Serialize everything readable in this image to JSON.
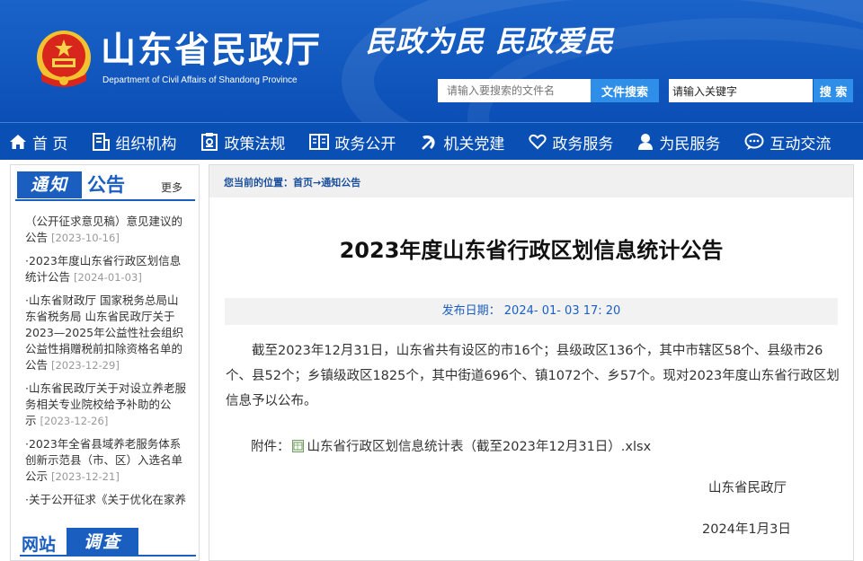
{
  "header": {
    "site_title": "山东省民政厅",
    "site_subtitle": "Department of Civil Affairs of Shandong Province",
    "slogan": "民政为民  民政爱民",
    "file_search": {
      "placeholder": "请输入要搜索的文件名",
      "button": "文件搜索"
    },
    "keyword_search": {
      "value": "请输入关键字",
      "button": "搜 索"
    }
  },
  "nav": {
    "items": [
      {
        "label": "首 页",
        "icon": "home-icon"
      },
      {
        "label": "组织机构",
        "icon": "org-icon"
      },
      {
        "label": "政策法规",
        "icon": "policy-icon"
      },
      {
        "label": "政务公开",
        "icon": "book-icon"
      },
      {
        "label": "机关党建",
        "icon": "party-icon"
      },
      {
        "label": "政务服务",
        "icon": "heart-icon"
      },
      {
        "label": "为民服务",
        "icon": "person-icon"
      },
      {
        "label": "互动交流",
        "icon": "chat-icon"
      }
    ]
  },
  "sidebar": {
    "notice_tag": "通知",
    "notice_title": "公告",
    "more": "更多",
    "notices": [
      {
        "title": "（公开征求意见稿）意见建议的",
        "title2": "公告",
        "date": "[2023-10-16]"
      },
      {
        "title": "·2023年度山东省行政区划信息",
        "title2": "统计公告",
        "date": "[2024-01-03]"
      },
      {
        "title": "·山东省财政厅 国家税务总局山",
        "title2": "东省税务局 山东省民政厅关于",
        "title3": "2023—2025年公益性社会组织",
        "title4": "公益性捐赠税前扣除资格名单的",
        "title5": "公告",
        "date": "[2023-12-29]"
      },
      {
        "title": "·山东省民政厅关于对设立养老服",
        "title2": "务相关专业院校给予补助的公",
        "title3": "示",
        "date": "[2023-12-26]"
      },
      {
        "title": "·2023年全省县域养老服务体系",
        "title2": "创新示范县（市、区）入选名单",
        "title3": "公示",
        "date": "[2023-12-21]"
      },
      {
        "title": "·关于公开征求《关于优化在家养"
      }
    ],
    "survey_left": "网站",
    "survey_right": "调查"
  },
  "article": {
    "breadcrumb": "您当前的位置：首页→通知公告",
    "title": "2023年度山东省行政区划信息统计公告",
    "pub_date": "发布日期：  2024- 01- 03 17: 20",
    "body": "截至2023年12月31日，山东省共有设区的市16个；县级政区136个，其中市辖区58个、县级市26个、县52个；乡镇级政区1825个，其中街道696个、镇1072个、乡57个。现对2023年度山东省行政区划信息予以公布。",
    "attach_label": "附件：",
    "attach_file": "山东省行政区划信息统计表（截至2023年12月31日）.xlsx",
    "signature": "山东省民政厅",
    "date": "2024年1月3日"
  }
}
